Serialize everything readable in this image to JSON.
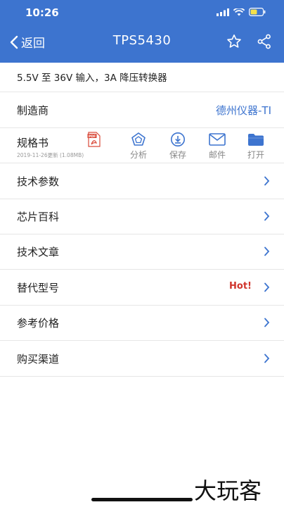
{
  "status": {
    "time": "10:26"
  },
  "nav": {
    "back_label": "返回",
    "title": "TPS5430"
  },
  "description": "5.5V 至 36V 输入，3A 降压转换器",
  "manufacturer": {
    "label": "制造商",
    "value": "德州仪器-TI"
  },
  "datasheet": {
    "label": "规格书",
    "meta": "2019-11-26更新 (1.08MB)",
    "tools": [
      {
        "label": "",
        "icon": "pdf-icon"
      },
      {
        "label": "分析",
        "icon": "pentagon-icon"
      },
      {
        "label": "保存",
        "icon": "download-icon"
      },
      {
        "label": "邮件",
        "icon": "mail-icon"
      },
      {
        "label": "打开",
        "icon": "folder-icon"
      }
    ]
  },
  "menu": [
    {
      "label": "技术参数"
    },
    {
      "label": "芯片百科"
    },
    {
      "label": "技术文章"
    },
    {
      "label": "替代型号",
      "badge": "Hot!"
    },
    {
      "label": "参考价格"
    },
    {
      "label": "购买渠道"
    }
  ],
  "watermark": "大玩客",
  "colors": {
    "accent": "#3d74cf",
    "hot": "#d0342c",
    "folder": "#3d74cf"
  }
}
